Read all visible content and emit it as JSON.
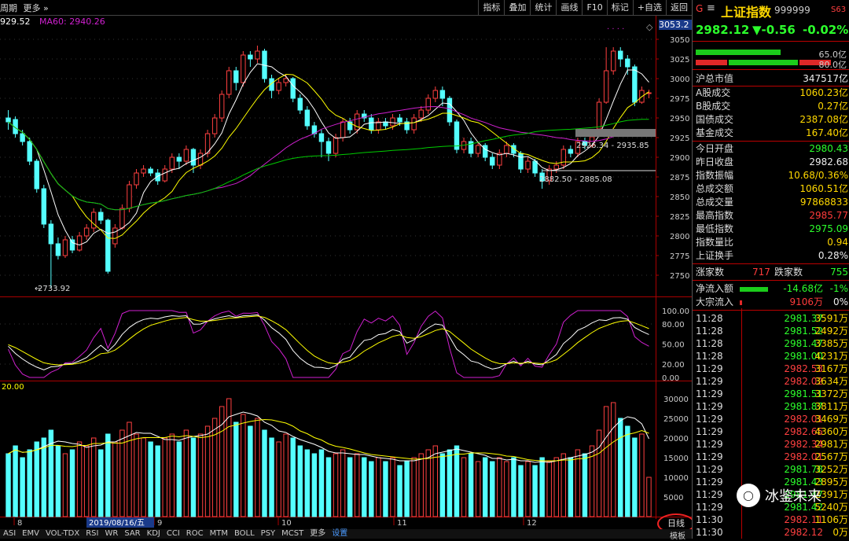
{
  "toolbar": {
    "period_label": "周期",
    "more_label": "更多",
    "buttons": [
      "指标",
      "叠加",
      "统计",
      "画线",
      "F10",
      "标记",
      "+自选",
      "返回"
    ]
  },
  "ma_legend": [
    {
      "text": "929.52",
      "color": "#ffffff"
    },
    {
      "text": "MA60: 2940.26",
      "color": "#00ff00"
    }
  ],
  "price_axis": {
    "ticks": [
      "3050",
      "3025",
      "3000",
      "2975",
      "2950",
      "2925",
      "2900",
      "2875",
      "2850",
      "2825",
      "2800",
      "2775",
      "2750"
    ],
    "current_box": "3053.2"
  },
  "annotations": {
    "low_label": "2733.92",
    "gap1": "2926.34 - 2935.85",
    "gap2": "2882.50 - 2885.08"
  },
  "kdj_axis": [
    "100.00",
    "80.00",
    "50.00",
    "20.00",
    "0.00"
  ],
  "vol_header": "20.00",
  "vol_axis": [
    "30000",
    "25000",
    "20000",
    "15000",
    "10000",
    "5000"
  ],
  "x_axis": {
    "labels": [
      "8",
      "9",
      "10",
      "11",
      "12"
    ],
    "highlight_date": "2019/08/16/五",
    "period_button": "日线"
  },
  "bottom_tabs": [
    "ASI",
    "EMV",
    "VOL-TDX",
    "RSI",
    "WR",
    "SAR",
    "KDJ",
    "CCI",
    "ROC",
    "MTM",
    "BOLL",
    "PSY",
    "MCST",
    "更多",
    "设置"
  ],
  "bottom_right_tab": "模板",
  "stock": {
    "tag_g": "G",
    "menu_icon": "≡",
    "name": "上证指数",
    "code": "999999",
    "badge": "S63",
    "price": "2982.12",
    "change": "▼-0.56",
    "pct": "-0.02%",
    "bar1_val": "65.0亿",
    "bar2_val": "80.0亿"
  },
  "stats_top": [
    {
      "label": "沪总市值",
      "value": "347517亿",
      "color": "white"
    }
  ],
  "stats_shares": [
    {
      "label": "A股成交",
      "value": "1060.23亿",
      "color": "yellow"
    },
    {
      "label": "B股成交",
      "value": "0.27亿",
      "color": "yellow"
    },
    {
      "label": "国债成交",
      "value": "2387.08亿",
      "color": "yellow"
    },
    {
      "label": "基金成交",
      "value": "167.40亿",
      "color": "yellow"
    }
  ],
  "stats_day": [
    {
      "label": "今日开盘",
      "value": "2980.43",
      "color": "green"
    },
    {
      "label": "昨日收盘",
      "value": "2982.68",
      "color": "white"
    },
    {
      "label": "指数振幅",
      "value": "10.68/0.36%",
      "color": "yellow"
    },
    {
      "label": "总成交额",
      "value": "1060.51亿",
      "color": "yellow"
    },
    {
      "label": "总成交量",
      "value": "97868833",
      "color": "yellow"
    },
    {
      "label": "最高指数",
      "value": "2985.77",
      "color": "red"
    },
    {
      "label": "最低指数",
      "value": "2975.09",
      "color": "green"
    },
    {
      "label": "指数量比",
      "value": "0.94",
      "color": "yellow"
    },
    {
      "label": "上证换手",
      "value": "0.28%",
      "color": "white"
    }
  ],
  "breadth": {
    "up_label": "涨家数",
    "up": "717",
    "down_label": "跌家数",
    "down": "755"
  },
  "flows": [
    {
      "label": "净流入额",
      "value": "-14.68亿",
      "pct": "-1%"
    },
    {
      "label": "大宗流入",
      "value": "9106万",
      "pct": "0%"
    }
  ],
  "ticks": [
    {
      "t": "11:28",
      "p": "2981.37",
      "v": "3591万"
    },
    {
      "t": "11:28",
      "p": "2981.52",
      "v": "2492万"
    },
    {
      "t": "11:28",
      "p": "2981.47",
      "v": "3385万"
    },
    {
      "t": "11:28",
      "p": "2981.00",
      "v": "4231万"
    },
    {
      "t": "11:29",
      "p": "2982.53",
      "v": "3167万"
    },
    {
      "t": "11:29",
      "p": "2982.02",
      "v": "3634万"
    },
    {
      "t": "11:29",
      "p": "2981.51",
      "v": "3372万"
    },
    {
      "t": "11:29",
      "p": "2981.87",
      "v": "3811万"
    },
    {
      "t": "11:29",
      "p": "2982.01",
      "v": "3469万"
    },
    {
      "t": "11:29",
      "p": "2982.65",
      "v": "4360万"
    },
    {
      "t": "11:29",
      "p": "2982.34",
      "v": "2981万"
    },
    {
      "t": "11:29",
      "p": "2982.01",
      "v": "2567万"
    },
    {
      "t": "11:29",
      "p": "2981.78",
      "v": "3252万"
    },
    {
      "t": "11:29",
      "p": "2981.43",
      "v": "2895万"
    },
    {
      "t": "11:29",
      "p": "2981.47",
      "v": "2391万"
    },
    {
      "t": "11:29",
      "p": "2981.42",
      "v": "5240万"
    },
    {
      "t": "11:30",
      "p": "2982.11",
      "v": "1106万"
    },
    {
      "t": "11:30",
      "p": "2982.12",
      "v": "0万"
    }
  ],
  "watermark": "冰鉴未来",
  "chart_data": {
    "type": "candlestick",
    "ylim": [
      2725,
      3060
    ],
    "candles": [
      [
        2950,
        2945,
        2960,
        2935
      ],
      [
        2948,
        2930,
        2952,
        2925
      ],
      [
        2930,
        2920,
        2935,
        2915
      ],
      [
        2920,
        2895,
        2925,
        2890
      ],
      [
        2895,
        2860,
        2898,
        2855
      ],
      [
        2860,
        2815,
        2865,
        2810
      ],
      [
        2815,
        2790,
        2820,
        2734
      ],
      [
        2790,
        2775,
        2798,
        2770
      ],
      [
        2775,
        2795,
        2800,
        2772
      ],
      [
        2795,
        2782,
        2800,
        2778
      ],
      [
        2782,
        2800,
        2805,
        2780
      ],
      [
        2800,
        2810,
        2815,
        2795
      ],
      [
        2810,
        2830,
        2835,
        2805
      ],
      [
        2830,
        2820,
        2835,
        2815
      ],
      [
        2820,
        2755,
        2822,
        2752
      ],
      [
        2790,
        2810,
        2815,
        2785
      ],
      [
        2810,
        2835,
        2840,
        2808
      ],
      [
        2835,
        2865,
        2870,
        2830
      ],
      [
        2865,
        2880,
        2885,
        2860
      ],
      [
        2880,
        2885,
        2890,
        2875
      ],
      [
        2885,
        2880,
        2888,
        2876
      ],
      [
        2880,
        2870,
        2885,
        2865
      ],
      [
        2870,
        2885,
        2890,
        2868
      ],
      [
        2885,
        2900,
        2905,
        2880
      ],
      [
        2900,
        2895,
        2905,
        2885
      ],
      [
        2895,
        2910,
        2915,
        2890
      ],
      [
        2910,
        2890,
        2912,
        2880
      ],
      [
        2890,
        2905,
        2910,
        2885
      ],
      [
        2905,
        2930,
        2935,
        2900
      ],
      [
        2930,
        2950,
        2955,
        2925
      ],
      [
        2950,
        2980,
        2985,
        2945
      ],
      [
        2980,
        3010,
        3015,
        2975
      ],
      [
        3010,
        2995,
        3015,
        2985
      ],
      [
        2995,
        3030,
        3035,
        2990
      ],
      [
        3030,
        3025,
        3035,
        3015
      ],
      [
        3025,
        3035,
        3042,
        3020
      ],
      [
        3035,
        3000,
        3038,
        2995
      ],
      [
        3000,
        2985,
        3005,
        2975
      ],
      [
        2985,
        2995,
        3000,
        2980
      ],
      [
        2995,
        3000,
        3005,
        2990
      ],
      [
        3000,
        2975,
        3002,
        2970
      ],
      [
        2975,
        2960,
        2980,
        2955
      ],
      [
        2960,
        2940,
        2965,
        2935
      ],
      [
        2940,
        2930,
        2945,
        2925
      ],
      [
        2930,
        2920,
        2935,
        2900
      ],
      [
        2920,
        2905,
        2925,
        2895
      ],
      [
        2905,
        2925,
        2930,
        2900
      ],
      [
        2925,
        2945,
        2950,
        2920
      ],
      [
        2945,
        2935,
        2950,
        2930
      ],
      [
        2935,
        2955,
        2960,
        2930
      ],
      [
        2955,
        2950,
        2960,
        2945
      ],
      [
        2950,
        2935,
        2955,
        2930
      ],
      [
        2935,
        2945,
        2950,
        2930
      ],
      [
        2945,
        2940,
        2950,
        2935
      ],
      [
        2940,
        2950,
        2955,
        2935
      ],
      [
        2950,
        2945,
        2955,
        2940
      ],
      [
        2945,
        2935,
        2950,
        2930
      ],
      [
        2935,
        2950,
        2955,
        2930
      ],
      [
        2950,
        2960,
        2965,
        2945
      ],
      [
        2960,
        2975,
        2980,
        2955
      ],
      [
        2975,
        2985,
        2990,
        2970
      ],
      [
        2985,
        2975,
        2990,
        2965
      ],
      [
        2975,
        2945,
        2978,
        2940
      ],
      [
        2945,
        2910,
        2948,
        2905
      ],
      [
        2910,
        2920,
        2925,
        2905
      ],
      [
        2920,
        2905,
        2925,
        2900
      ],
      [
        2905,
        2915,
        2920,
        2900
      ],
      [
        2915,
        2900,
        2918,
        2895
      ],
      [
        2900,
        2890,
        2905,
        2885
      ],
      [
        2890,
        2905,
        2910,
        2885
      ],
      [
        2905,
        2915,
        2920,
        2900
      ],
      [
        2915,
        2905,
        2918,
        2900
      ],
      [
        2905,
        2885,
        2908,
        2880
      ],
      [
        2885,
        2895,
        2900,
        2880
      ],
      [
        2895,
        2880,
        2898,
        2875
      ],
      [
        2880,
        2870,
        2885,
        2860
      ],
      [
        2870,
        2885,
        2890,
        2865
      ],
      [
        2885,
        2890,
        2895,
        2880
      ],
      [
        2890,
        2910,
        2915,
        2885
      ],
      [
        2910,
        2905,
        2915,
        2900
      ],
      [
        2905,
        2920,
        2925,
        2900
      ],
      [
        2920,
        2915,
        2925,
        2910
      ],
      [
        2915,
        2926,
        2930,
        2912
      ],
      [
        2936,
        2970,
        2975,
        2935
      ],
      [
        2970,
        3010,
        3040,
        2968
      ],
      [
        3010,
        3035,
        3040,
        3005
      ],
      [
        3035,
        3025,
        3040,
        3015
      ],
      [
        3025,
        3015,
        3030,
        3005
      ],
      [
        3015,
        2970,
        3018,
        2965
      ],
      [
        2970,
        2985,
        2990,
        2968
      ],
      [
        2982,
        2982,
        2986,
        2975
      ]
    ],
    "volumes": [
      16000,
      18000,
      15000,
      17000,
      19000,
      20000,
      22000,
      18000,
      16000,
      17000,
      19000,
      18000,
      20000,
      17000,
      21000,
      19000,
      22000,
      24000,
      21000,
      20000,
      19000,
      18000,
      20000,
      21000,
      19000,
      22000,
      20000,
      21000,
      23000,
      25000,
      28000,
      30000,
      24000,
      26000,
      23000,
      25000,
      22000,
      20000,
      19000,
      21000,
      20000,
      18000,
      17000,
      16000,
      17000,
      15000,
      16000,
      17000,
      15000,
      16000,
      15000,
      14000,
      15000,
      14000,
      15000,
      13000,
      14000,
      15000,
      16000,
      17000,
      18000,
      16000,
      17000,
      18000,
      15000,
      16000,
      14000,
      15000,
      14000,
      15000,
      14000,
      15000,
      13000,
      14000,
      13000,
      15000,
      14000,
      15000,
      16000,
      15000,
      17000,
      16000,
      18000,
      22000,
      28000,
      29000,
      25000,
      23000,
      20000,
      21000,
      10000
    ]
  }
}
